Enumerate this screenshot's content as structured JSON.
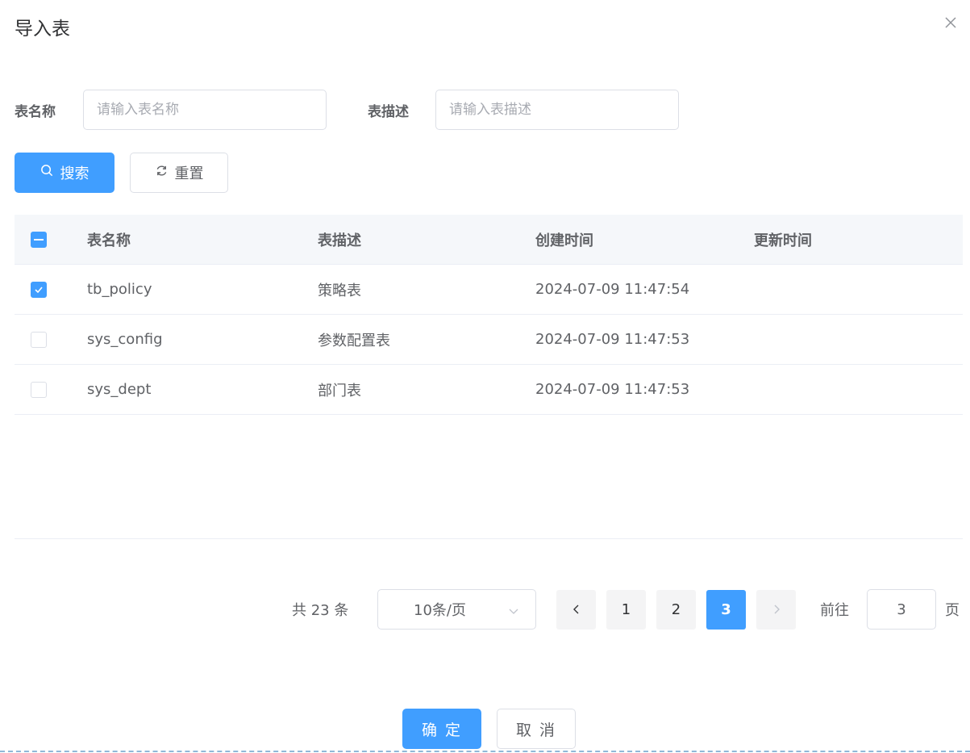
{
  "dialog": {
    "title": "导入表",
    "close_icon": "close-icon"
  },
  "search_form": {
    "table_name_label": "表名称",
    "table_name_placeholder": "请输入表名称",
    "table_name_value": "",
    "table_desc_label": "表描述",
    "table_desc_placeholder": "请输入表描述",
    "table_desc_value": "",
    "search_button_label": "搜索",
    "search_icon": "search-icon",
    "reset_button_label": "重置",
    "reset_icon": "refresh-icon"
  },
  "table": {
    "select_all_state": "indeterminate",
    "columns": [
      "表名称",
      "表描述",
      "创建时间",
      "更新时间"
    ],
    "rows": [
      {
        "checked": true,
        "name": "tb_policy",
        "desc": "策略表",
        "created": "2024-07-09 11:47:54",
        "updated": ""
      },
      {
        "checked": false,
        "name": "sys_config",
        "desc": "参数配置表",
        "created": "2024-07-09 11:47:53",
        "updated": ""
      },
      {
        "checked": false,
        "name": "sys_dept",
        "desc": "部门表",
        "created": "2024-07-09 11:47:53",
        "updated": ""
      }
    ]
  },
  "pagination": {
    "total_text": "共 23 条",
    "page_size": "10条/页",
    "pages": [
      "1",
      "2",
      "3"
    ],
    "current_page": "3",
    "goto_label": "前往",
    "goto_value": "3",
    "goto_suffix": "页"
  },
  "footer": {
    "confirm_label": "确 定",
    "cancel_label": "取 消"
  },
  "colors": {
    "primary": "#409eff",
    "border": "#dcdfe6",
    "header_bg": "#f5f7fa",
    "text": "#606266"
  }
}
